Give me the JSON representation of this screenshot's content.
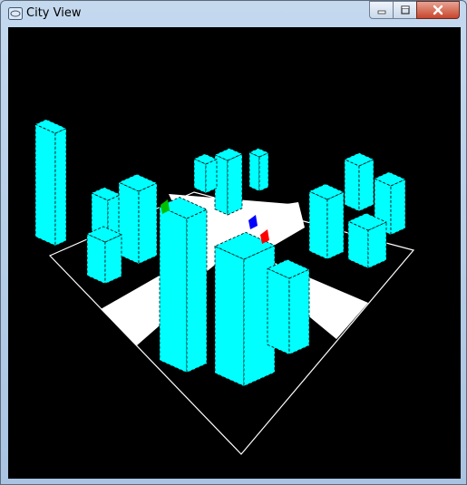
{
  "window": {
    "title": "City View"
  },
  "controls": {
    "minimize": "minimize-icon",
    "maximize": "maximize-icon",
    "close": "close-icon"
  },
  "scene": {
    "background": "#000000",
    "ground_color": "#ffffff",
    "building_color": "#00ffff",
    "edge_color": "#000000",
    "markers": [
      {
        "name": "green-marker",
        "color": "#00c000"
      },
      {
        "name": "blue-marker",
        "color": "#0000ff"
      },
      {
        "name": "red-marker",
        "color": "#ff0000"
      }
    ]
  }
}
